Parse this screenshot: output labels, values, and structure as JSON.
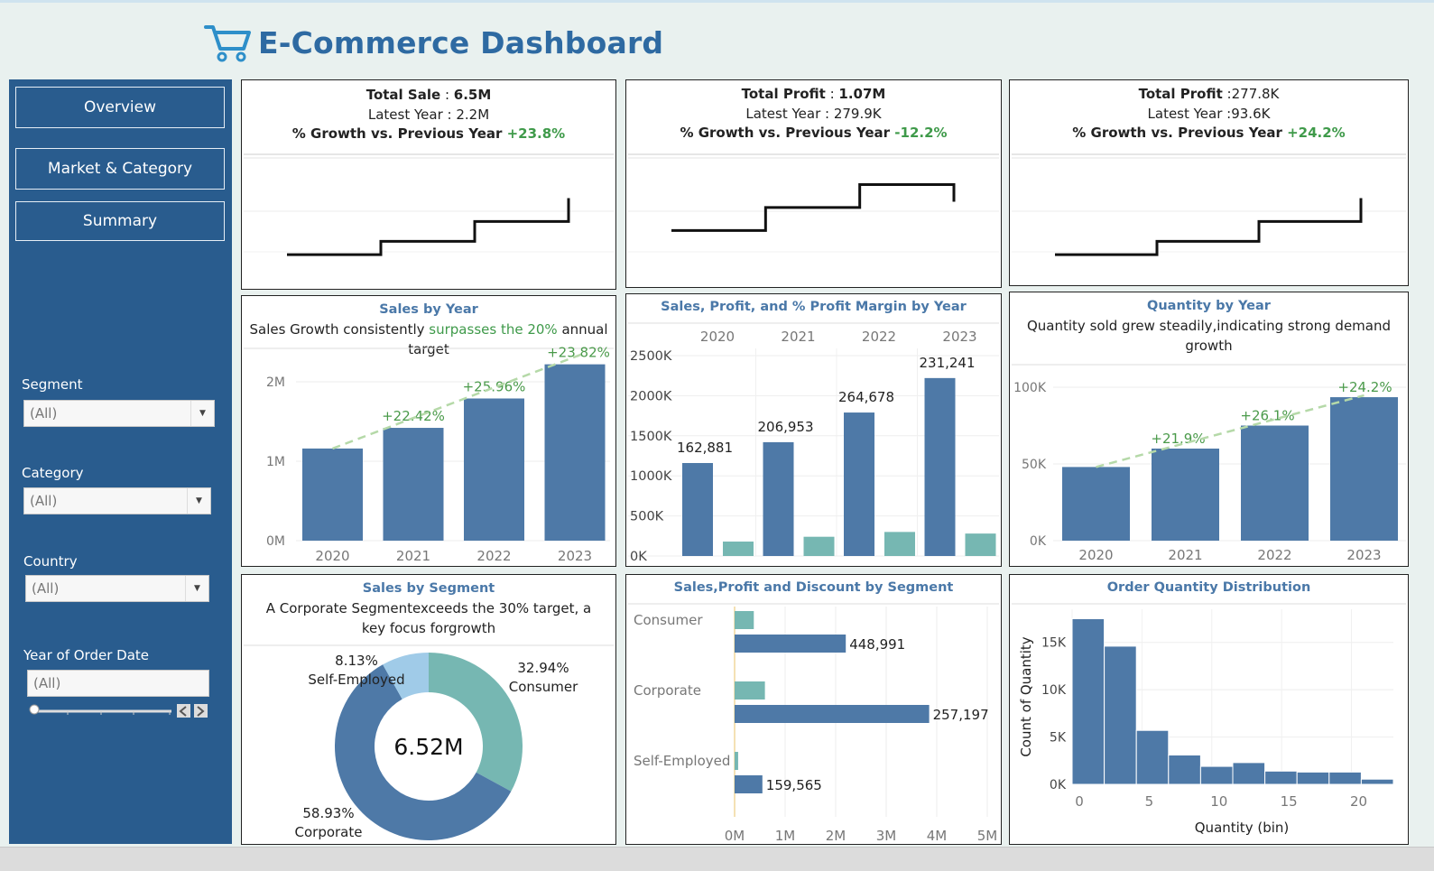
{
  "header": {
    "title": "E-Commerce Dashboard",
    "icon": "shopping-cart-icon"
  },
  "sidebar": {
    "nav": [
      "Overview",
      "Market & Category",
      "Summary"
    ],
    "filters": {
      "segment": {
        "label": "Segment",
        "value": "(All)"
      },
      "category": {
        "label": "Category",
        "value": "(All)"
      },
      "country": {
        "label": "Country",
        "value": "(All)"
      },
      "year": {
        "label": "Year of Order Date",
        "value": "(All)"
      }
    }
  },
  "kpis": [
    {
      "label": "Total Sale",
      "sep": " : ",
      "value": "6.5M",
      "latest_label": "Latest Year : ",
      "latest": "2.2M",
      "growth_label": "% Growth vs. Previous Year ",
      "growth": "+23.8%",
      "trend": [
        1.0,
        1.2,
        1.5,
        1.85
      ],
      "range": [
        0.5,
        2.4
      ]
    },
    {
      "label": "Total Profit",
      "sep": " : ",
      "value": "1.07M",
      "latest_label": "Latest Year : ",
      "latest": "279.9K",
      "growth_label": "% Growth vs. Previous Year  ",
      "growth": "-12.2%",
      "trend": [
        0.2,
        0.24,
        0.28,
        0.28,
        0.25
      ],
      "range": [
        0.1,
        0.32
      ]
    },
    {
      "label": "Total Profit",
      "sep": " :",
      "value": "277.8K",
      "latest_label": "Latest Year :",
      "latest": "93.6K",
      "growth_label": "% Growth vs. Previous Year ",
      "growth": "+24.2%",
      "trend": [
        1.0,
        1.2,
        1.5,
        1.85
      ],
      "range": [
        0.5,
        2.4
      ]
    }
  ],
  "sales_by_year": {
    "title": "Sales by Year",
    "subtitle": {
      "a": "Sales Growth",
      "b": " consistently ",
      "c": "surpasses the 20%",
      "d": " annual target"
    }
  },
  "spm": {
    "title": "Sales, Profit, and % Profit Margin by Year"
  },
  "qty": {
    "title": "Quantity by Year",
    "subtitle": "Quantity sold grew steadily,indicating strong demand growth"
  },
  "segment": {
    "title": "Sales by Segment",
    "subtitle": "A Corporate Segmentexceeds the 30% target, a key focus forgrowth",
    "center": "6.52M"
  },
  "spd": {
    "title": "Sales,Profit and Discount by Segment"
  },
  "dist": {
    "title": "Order Quantity Distribution"
  },
  "colors": {
    "primary": "#4e79a7",
    "teal": "#76b7b2",
    "light": "#a0cbe8",
    "accent_green": "#3f9a4a",
    "sidebar": "#295c8e"
  },
  "chart_data": [
    {
      "type": "bar",
      "id": "sales_by_year",
      "title": "Sales by Year",
      "categories": [
        "2020",
        "2021",
        "2022",
        "2023"
      ],
      "values": [
        1.16,
        1.42,
        1.79,
        2.22
      ],
      "value_labels": [
        "",
        "+22.42%",
        "+25.96%",
        "+23.82%"
      ],
      "yticks": [
        "0M",
        "1M",
        "2M"
      ],
      "ylim": [
        0,
        2.25
      ],
      "unit": "M",
      "trendline": true
    },
    {
      "type": "bar",
      "id": "sales_profit_margin",
      "title": "Sales, Profit, and % Profit Margin by Year",
      "categories": [
        "2020",
        "2021",
        "2022",
        "2023"
      ],
      "series": [
        {
          "name": "Sales",
          "values": [
            1160,
            1420,
            1790,
            2220
          ],
          "labels": [
            "162,881",
            "206,953",
            "264,678",
            "231,241"
          ]
        },
        {
          "name": "Profit",
          "values": [
            180,
            240,
            300,
            280
          ]
        }
      ],
      "yticks": [
        "0K",
        "500K",
        "1000K",
        "1500K",
        "2000K",
        "2500K"
      ],
      "ylim": [
        0,
        2500
      ]
    },
    {
      "type": "bar",
      "id": "quantity_by_year",
      "title": "Quantity by Year",
      "categories": [
        "2020",
        "2021",
        "2022",
        "2023"
      ],
      "values": [
        48000,
        60000,
        75000,
        93500
      ],
      "value_labels": [
        "",
        "+21.9%",
        "+26.1%",
        "+24.2%"
      ],
      "yticks": [
        "0K",
        "50K",
        "100K"
      ],
      "ylim": [
        0,
        110000
      ],
      "trendline": true
    },
    {
      "type": "pie",
      "id": "sales_by_segment",
      "title": "Sales by Segment",
      "categories": [
        "Consumer",
        "Corporate",
        "Self-Employed"
      ],
      "values": [
        32.94,
        58.93,
        8.13
      ],
      "labels": [
        "32.94%",
        "58.93%",
        "8.13%"
      ],
      "center": "6.52M"
    },
    {
      "type": "bar",
      "id": "segment_spd",
      "title": "Sales,Profit and Discount by Segment",
      "orientation": "horizontal",
      "categories": [
        "Consumer",
        "Corporate",
        "Self-Employed"
      ],
      "series": [
        {
          "name": "Profit",
          "values": [
            0.38,
            0.6,
            0.07
          ]
        },
        {
          "name": "Sales",
          "values": [
            2.2,
            3.85,
            0.55
          ],
          "labels": [
            "448,991",
            "257,197",
            "159,565"
          ]
        }
      ],
      "xticks": [
        "0M",
        "1M",
        "2M",
        "3M",
        "4M",
        "5M"
      ],
      "xlim": [
        0,
        5
      ]
    },
    {
      "type": "bar",
      "id": "order_qty_distribution",
      "title": "Order Quantity Distribution",
      "xlabel": "Quantity (bin)",
      "ylabel": "Count of Quantity",
      "bins": [
        0,
        2.3,
        4.6,
        6.9,
        9.2,
        11.5,
        13.8,
        16.1,
        18.4,
        20.7
      ],
      "values": [
        17500,
        14600,
        5700,
        3100,
        1900,
        2300,
        1400,
        1300,
        1300,
        550
      ],
      "xticks": [
        "0",
        "5",
        "10",
        "15",
        "20"
      ],
      "yticks": [
        "0K",
        "5K",
        "10K",
        "15K"
      ],
      "ylim": [
        0,
        18500
      ]
    }
  ]
}
